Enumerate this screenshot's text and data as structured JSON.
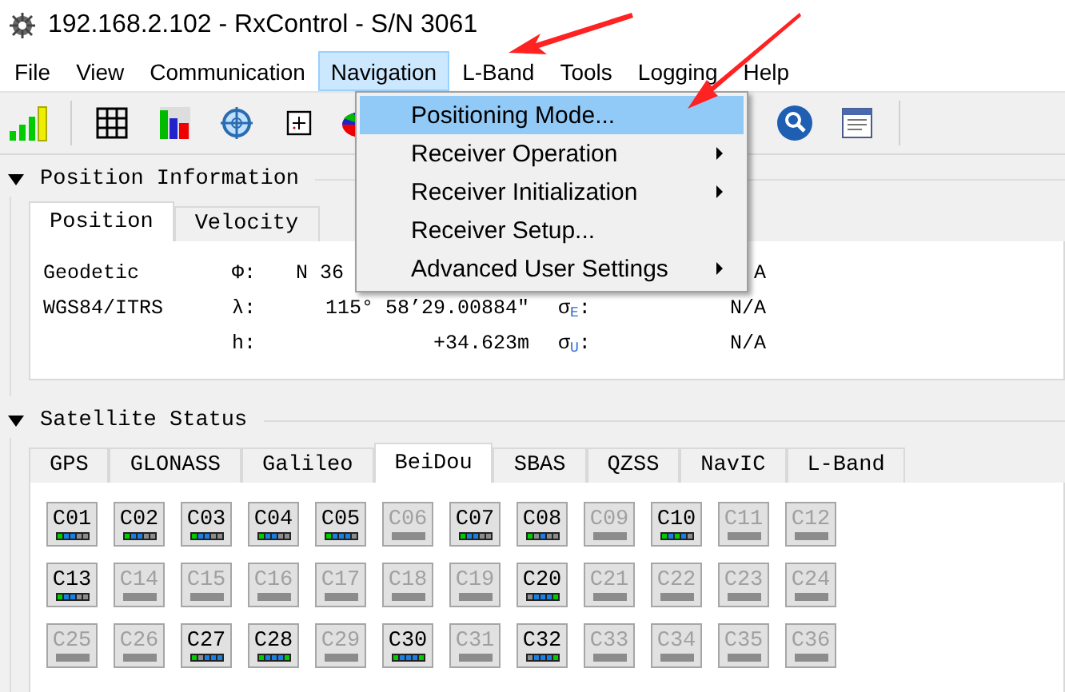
{
  "window": {
    "title": "192.168.2.102 - RxControl - S/N 3061"
  },
  "menu_bar": [
    {
      "label": "File",
      "selected": false
    },
    {
      "label": "View",
      "selected": false
    },
    {
      "label": "Communication",
      "selected": false
    },
    {
      "label": "Navigation",
      "selected": true
    },
    {
      "label": "L-Band",
      "selected": false
    },
    {
      "label": "Tools",
      "selected": false
    },
    {
      "label": "Logging",
      "selected": false
    },
    {
      "label": "Help",
      "selected": false
    }
  ],
  "menu": {
    "items": [
      {
        "label": "Positioning Mode...",
        "selected": true,
        "submenu": false
      },
      {
        "label": "Receiver Operation",
        "selected": false,
        "submenu": true
      },
      {
        "label": "Receiver Initialization",
        "selected": false,
        "submenu": true
      },
      {
        "label": "Receiver Setup...",
        "selected": false,
        "submenu": false
      },
      {
        "label": "Advanced User Settings",
        "selected": false,
        "submenu": true
      }
    ]
  },
  "position_information": {
    "title": "Position Information",
    "expanded": true,
    "tabs": [
      {
        "label": "Position",
        "selected": true
      },
      {
        "label": "Velocity",
        "selected": false
      }
    ],
    "rows": [
      {
        "kind": "latitude",
        "label": "Geodetic",
        "symbol": "Φ:",
        "value": "N 36",
        "sigma_value": "A"
      },
      {
        "kind": "longitude",
        "label": "WGS84/ITRS",
        "symbol": "λ:",
        "value": "115° 58’29.00884″",
        "sigma": "σ$_{E}$:",
        "sigma_value": "N/A"
      },
      {
        "kind": "height",
        "symbol": "h:",
        "value": "+34.623m",
        "sigma": "σ$_{U}$:",
        "sigma_value": "N/A"
      }
    ]
  },
  "satellite_status": {
    "title": "Satellite Status",
    "expanded": true,
    "tabs": [
      {
        "label": "GPS",
        "selected": false
      },
      {
        "label": "GLONASS",
        "selected": false
      },
      {
        "label": "Galileo",
        "selected": false
      },
      {
        "label": "BeiDou",
        "selected": true
      },
      {
        "label": "SBAS",
        "selected": false
      },
      {
        "label": "QZSS",
        "selected": false
      },
      {
        "label": "NavIC",
        "selected": false
      },
      {
        "label": "L-Band",
        "selected": false
      }
    ],
    "satellites": [
      {
        "id": "C01",
        "active": true,
        "segments": [
          {
            "color": "#00cc00"
          },
          {
            "color": "#1a7fe0"
          },
          {
            "color": "#1a7fe0"
          },
          {
            "color": "#8c8c8c"
          },
          {
            "color": "#8c8c8c"
          }
        ]
      },
      {
        "id": "C02",
        "active": true,
        "segments": [
          {
            "color": "#00cc00"
          },
          {
            "color": "#1a7fe0"
          },
          {
            "color": "#1a7fe0"
          },
          {
            "color": "#8c8c8c"
          },
          {
            "color": "#8c8c8c"
          }
        ]
      },
      {
        "id": "C03",
        "active": true,
        "segments": [
          {
            "color": "#00cc00"
          },
          {
            "color": "#1a7fe0"
          },
          {
            "color": "#1a7fe0"
          },
          {
            "color": "#8c8c8c"
          },
          {
            "color": "#8c8c8c"
          }
        ]
      },
      {
        "id": "C04",
        "active": true,
        "segments": [
          {
            "color": "#00cc00"
          },
          {
            "color": "#1a7fe0"
          },
          {
            "color": "#1a7fe0"
          },
          {
            "color": "#8c8c8c"
          },
          {
            "color": "#8c8c8c"
          }
        ]
      },
      {
        "id": "C05",
        "active": true,
        "segments": [
          {
            "color": "#00cc00"
          },
          {
            "color": "#1a7fe0"
          },
          {
            "color": "#1a7fe0"
          },
          {
            "color": "#1a7fe0"
          },
          {
            "color": "#8c8c8c"
          }
        ]
      },
      {
        "id": "C06",
        "active": false
      },
      {
        "id": "C07",
        "active": true,
        "segments": [
          {
            "color": "#00cc00"
          },
          {
            "color": "#1a7fe0"
          },
          {
            "color": "#1a7fe0"
          },
          {
            "color": "#8c8c8c"
          },
          {
            "color": "#8c8c8c"
          }
        ]
      },
      {
        "id": "C08",
        "active": true,
        "segments": [
          {
            "color": "#00cc00"
          },
          {
            "color": "#8c8c8c"
          },
          {
            "color": "#1a7fe0"
          },
          {
            "color": "#8c8c8c"
          },
          {
            "color": "#8c8c8c"
          }
        ]
      },
      {
        "id": "C09",
        "active": false
      },
      {
        "id": "C10",
        "active": true,
        "segments": [
          {
            "color": "#00cc00"
          },
          {
            "color": "#1a7fe0"
          },
          {
            "color": "#00cc00"
          },
          {
            "color": "#1a7fe0"
          },
          {
            "color": "#8c8c8c"
          }
        ]
      },
      {
        "id": "C11",
        "active": false
      },
      {
        "id": "C12",
        "active": false
      },
      {
        "id": "C13",
        "active": true,
        "segments": [
          {
            "color": "#00cc00"
          },
          {
            "color": "#1a7fe0"
          },
          {
            "color": "#1a7fe0"
          },
          {
            "color": "#8c8c8c"
          },
          {
            "color": "#8c8c8c"
          }
        ]
      },
      {
        "id": "C14",
        "active": false
      },
      {
        "id": "C15",
        "active": false
      },
      {
        "id": "C16",
        "active": false
      },
      {
        "id": "C17",
        "active": false
      },
      {
        "id": "C18",
        "active": false
      },
      {
        "id": "C19",
        "active": false
      },
      {
        "id": "C20",
        "active": true,
        "segments": [
          {
            "color": "#8c8c8c"
          },
          {
            "color": "#1a7fe0"
          },
          {
            "color": "#1a7fe0"
          },
          {
            "color": "#1a7fe0"
          },
          {
            "color": "#00cc00"
          }
        ]
      },
      {
        "id": "C21",
        "active": false
      },
      {
        "id": "C22",
        "active": false
      },
      {
        "id": "C23",
        "active": false
      },
      {
        "id": "C24",
        "active": false
      },
      {
        "id": "C25",
        "active": false
      },
      {
        "id": "C26",
        "active": false
      },
      {
        "id": "C27",
        "active": true,
        "segments": [
          {
            "color": "#00cc00"
          },
          {
            "color": "#8c8c8c"
          },
          {
            "color": "#1a7fe0"
          },
          {
            "color": "#1a7fe0"
          },
          {
            "color": "#1a7fe0"
          }
        ]
      },
      {
        "id": "C28",
        "active": true,
        "segments": [
          {
            "color": "#00cc00"
          },
          {
            "color": "#1a7fe0"
          },
          {
            "color": "#1a7fe0"
          },
          {
            "color": "#1a7fe0"
          },
          {
            "color": "#00cc00"
          }
        ]
      },
      {
        "id": "C29",
        "active": false
      },
      {
        "id": "C30",
        "active": true,
        "segments": [
          {
            "color": "#00cc00"
          },
          {
            "color": "#1a7fe0"
          },
          {
            "color": "#1a7fe0"
          },
          {
            "color": "#1a7fe0"
          },
          {
            "color": "#00cc00"
          }
        ]
      },
      {
        "id": "C31",
        "active": false
      },
      {
        "id": "C32",
        "active": true,
        "segments": [
          {
            "color": "#8c8c8c"
          },
          {
            "color": "#1a7fe0"
          },
          {
            "color": "#1a7fe0"
          },
          {
            "color": "#1a7fe0"
          },
          {
            "color": "#00cc00"
          }
        ]
      },
      {
        "id": "C33",
        "active": false
      },
      {
        "id": "C34",
        "active": false
      },
      {
        "id": "C35",
        "active": false
      },
      {
        "id": "C36",
        "active": false
      }
    ]
  }
}
